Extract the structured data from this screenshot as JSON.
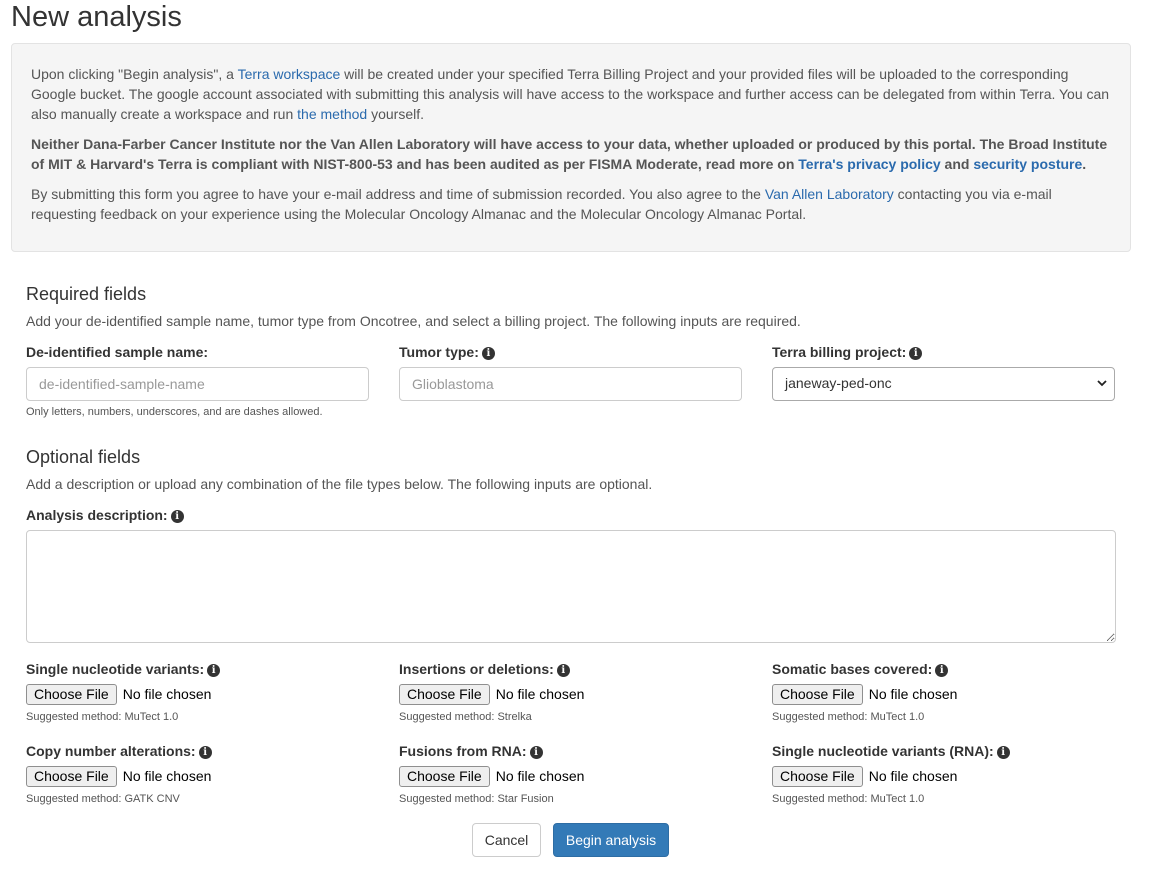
{
  "page_title": "New analysis",
  "notice": {
    "p1_before": "Upon clicking \"Begin analysis\", a ",
    "p1_link1": "Terra workspace",
    "p1_mid": " will be created under your specified Terra Billing Project and your provided files will be uploaded to the corresponding Google bucket. The google account associated with submitting this analysis will have access to the workspace and further access can be delegated from within Terra. You can also manually create a workspace and run ",
    "p1_link2": "the method",
    "p1_after": " yourself.",
    "p2_before": "Neither Dana-Farber Cancer Institute nor the Van Allen Laboratory will have access to your data, whether uploaded or produced by this portal. The Broad Institute of MIT & Harvard's Terra is compliant with NIST-800-53 and has been audited as per FISMA Moderate, read more on ",
    "p2_link1": "Terra's privacy policy",
    "p2_mid": " and ",
    "p2_link2": "security posture",
    "p2_after": ".",
    "p3_before": "By submitting this form you agree to have your e-mail address and time of submission recorded. You also agree to the ",
    "p3_link": "Van Allen Laboratory",
    "p3_after": " contacting you via e-mail requesting feedback on your experience using the Molecular Oncology Almanac and the Molecular Oncology Almanac Portal."
  },
  "required": {
    "heading": "Required fields",
    "description": "Add your de-identified sample name, tumor type from Oncotree, and select a billing project. The following inputs are required.",
    "sample_label": "De-identified sample name:",
    "sample_placeholder": "de-identified-sample-name",
    "sample_help": "Only letters, numbers, underscores, and are dashes allowed.",
    "tumor_label": "Tumor type:",
    "tumor_placeholder": "Glioblastoma",
    "billing_label": "Terra billing project:",
    "billing_value": "janeway-ped-onc"
  },
  "optional": {
    "heading": "Optional fields",
    "description": "Add a description or upload any combination of the file types below. The following inputs are optional.",
    "description_label": "Analysis description:",
    "choose_file": "Choose File",
    "no_file": "No file chosen",
    "files": [
      {
        "label": "Single nucleotide variants:",
        "method": "Suggested method: MuTect 1.0"
      },
      {
        "label": "Insertions or deletions:",
        "method": "Suggested method: Strelka"
      },
      {
        "label": "Somatic bases covered:",
        "method": "Suggested method: MuTect 1.0"
      },
      {
        "label": "Copy number alterations:",
        "method": "Suggested method: GATK CNV"
      },
      {
        "label": "Fusions from RNA:",
        "method": "Suggested method: Star Fusion"
      },
      {
        "label": "Single nucleotide variants (RNA):",
        "method": "Suggested method: MuTect 1.0"
      }
    ]
  },
  "actions": {
    "cancel": "Cancel",
    "submit": "Begin analysis"
  },
  "info_icon_glyph": "i",
  "colors": {
    "link": "#2a6aad",
    "primary_button": "#337ab7",
    "well_background": "#f5f5f5"
  }
}
